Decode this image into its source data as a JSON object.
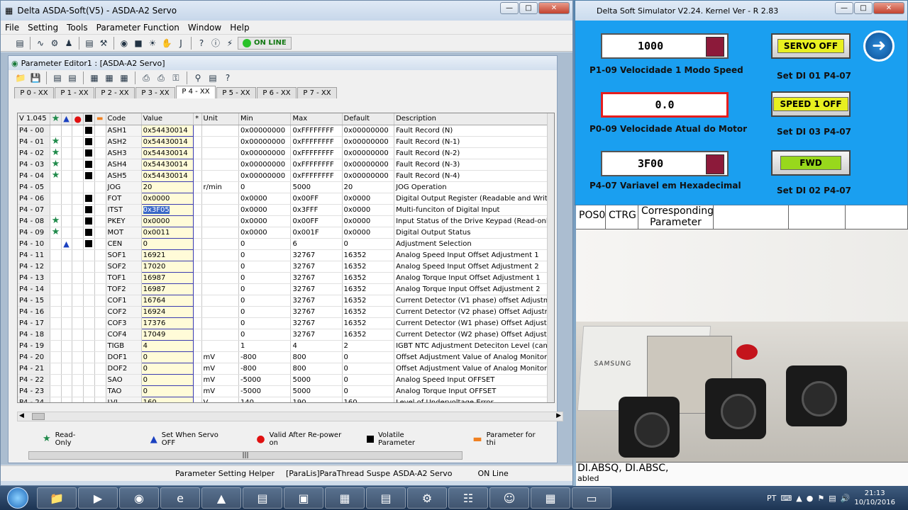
{
  "main_window": {
    "title": "Delta ASDA-Soft(V5) - ASDA-A2 Servo",
    "menu": [
      "File",
      "Setting",
      "Tools",
      "Parameter Function",
      "Window",
      "Help"
    ],
    "online_label": "ON LINE"
  },
  "editor": {
    "title": "Parameter Editor1 : [ASDA-A2 Servo]",
    "tabs": [
      "P 0 - XX",
      "P 1 - XX",
      "P 2 - XX",
      "P 3 - XX",
      "P 4 - XX",
      "P 5 - XX",
      "P 6 - XX",
      "P 7 - XX"
    ],
    "active_tab": 4,
    "headers": {
      "version": "V 1.045",
      "code": "Code",
      "value": "Value",
      "flag": "*",
      "unit": "Unit",
      "min": "Min",
      "max": "Max",
      "default": "Default",
      "description": "Description"
    },
    "rows": [
      {
        "p": "P4 - 00",
        "star": false,
        "tri": false,
        "sq": true,
        "code": "ASH1",
        "value": "0x54430014",
        "unit": "",
        "min": "0x00000000",
        "max": "0xFFFFFFFF",
        "def": "0x00000000",
        "desc": "Fault Record (N)"
      },
      {
        "p": "P4 - 01",
        "star": true,
        "tri": false,
        "sq": true,
        "code": "ASH2",
        "value": "0x54430014",
        "unit": "",
        "min": "0x00000000",
        "max": "0xFFFFFFFF",
        "def": "0x00000000",
        "desc": "Fault Record (N-1)"
      },
      {
        "p": "P4 - 02",
        "star": true,
        "tri": false,
        "sq": true,
        "code": "ASH3",
        "value": "0x54430014",
        "unit": "",
        "min": "0x00000000",
        "max": "0xFFFFFFFF",
        "def": "0x00000000",
        "desc": "Fault Record (N-2)"
      },
      {
        "p": "P4 - 03",
        "star": true,
        "tri": false,
        "sq": true,
        "code": "ASH4",
        "value": "0x54430014",
        "unit": "",
        "min": "0x00000000",
        "max": "0xFFFFFFFF",
        "def": "0x00000000",
        "desc": "Fault Record (N-3)"
      },
      {
        "p": "P4 - 04",
        "star": true,
        "tri": false,
        "sq": true,
        "code": "ASH5",
        "value": "0x54430014",
        "unit": "",
        "min": "0x00000000",
        "max": "0xFFFFFFFF",
        "def": "0x00000000",
        "desc": "Fault Record (N-4)"
      },
      {
        "p": "P4 - 05",
        "star": false,
        "tri": false,
        "sq": false,
        "code": "JOG",
        "value": "20",
        "unit": "r/min",
        "min": "0",
        "max": "5000",
        "def": "20",
        "desc": "JOG Operation"
      },
      {
        "p": "P4 - 06",
        "star": false,
        "tri": false,
        "sq": true,
        "code": "FOT",
        "value": "0x0000",
        "unit": "",
        "min": "0x0000",
        "max": "0x00FF",
        "def": "0x0000",
        "desc": "Digital Output Register (Readable and Writa"
      },
      {
        "p": "P4 - 07",
        "star": false,
        "tri": false,
        "sq": true,
        "code": "ITST",
        "value": "0x3F05",
        "unit": "",
        "min": "0x0000",
        "max": "0x3FFF",
        "def": "0x0000",
        "desc": "Multi-funciton of Digital Input",
        "selected": true
      },
      {
        "p": "P4 - 08",
        "star": true,
        "tri": false,
        "sq": true,
        "code": "PKEY",
        "value": "0x0000",
        "unit": "",
        "min": "0x0000",
        "max": "0x00FF",
        "def": "0x0000",
        "desc": "Input Status of the Drive Keypad (Read-onl"
      },
      {
        "p": "P4 - 09",
        "star": true,
        "tri": false,
        "sq": true,
        "code": "MOT",
        "value": "0x0011",
        "unit": "",
        "min": "0x0000",
        "max": "0x001F",
        "def": "0x0000",
        "desc": "Digital Output Status"
      },
      {
        "p": "P4 - 10",
        "star": false,
        "tri": true,
        "sq": true,
        "code": "CEN",
        "value": "0",
        "unit": "",
        "min": "0",
        "max": "6",
        "def": "0",
        "desc": "Adjustment Selection"
      },
      {
        "p": "P4 - 11",
        "star": false,
        "tri": false,
        "sq": false,
        "code": "SOF1",
        "value": "16921",
        "unit": "",
        "min": "0",
        "max": "32767",
        "def": "16352",
        "desc": "Analog Speed Input Offset Adjustment 1"
      },
      {
        "p": "P4 - 12",
        "star": false,
        "tri": false,
        "sq": false,
        "code": "SOF2",
        "value": "17020",
        "unit": "",
        "min": "0",
        "max": "32767",
        "def": "16352",
        "desc": "Analog Speed Input Offset Adjustment 2"
      },
      {
        "p": "P4 - 13",
        "star": false,
        "tri": false,
        "sq": false,
        "code": "TOF1",
        "value": "16987",
        "unit": "",
        "min": "0",
        "max": "32767",
        "def": "16352",
        "desc": "Analog Torque Input Offset Adjustment 1"
      },
      {
        "p": "P4 - 14",
        "star": false,
        "tri": false,
        "sq": false,
        "code": "TOF2",
        "value": "16987",
        "unit": "",
        "min": "0",
        "max": "32767",
        "def": "16352",
        "desc": "Analog Torque Input Offset Adjustment 2"
      },
      {
        "p": "P4 - 15",
        "star": false,
        "tri": false,
        "sq": false,
        "code": "COF1",
        "value": "16764",
        "unit": "",
        "min": "0",
        "max": "32767",
        "def": "16352",
        "desc": "Current Detector (V1 phase) offset Adjustm"
      },
      {
        "p": "P4 - 16",
        "star": false,
        "tri": false,
        "sq": false,
        "code": "COF2",
        "value": "16924",
        "unit": "",
        "min": "0",
        "max": "32767",
        "def": "16352",
        "desc": "Current Detector (V2 phase) Offset Adjustr"
      },
      {
        "p": "P4 - 17",
        "star": false,
        "tri": false,
        "sq": false,
        "code": "COF3",
        "value": "17376",
        "unit": "",
        "min": "0",
        "max": "32767",
        "def": "16352",
        "desc": "Current Detector (W1 phase) Offset Adjust"
      },
      {
        "p": "P4 - 18",
        "star": false,
        "tri": false,
        "sq": false,
        "code": "COF4",
        "value": "17049",
        "unit": "",
        "min": "0",
        "max": "32767",
        "def": "16352",
        "desc": "Current Detector (W2 phase) Offset Adjust"
      },
      {
        "p": "P4 - 19",
        "star": false,
        "tri": false,
        "sq": false,
        "code": "TIGB",
        "value": "4",
        "unit": "",
        "min": "1",
        "max": "4",
        "def": "2",
        "desc": "IGBT NTC Adjustment Deteciton Level (canr"
      },
      {
        "p": "P4 - 20",
        "star": false,
        "tri": false,
        "sq": false,
        "code": "DOF1",
        "value": "0",
        "unit": "mV",
        "min": "-800",
        "max": "800",
        "def": "0",
        "desc": "Offset Adjustment Value of Analog Monitor"
      },
      {
        "p": "P4 - 21",
        "star": false,
        "tri": false,
        "sq": false,
        "code": "DOF2",
        "value": "0",
        "unit": "mV",
        "min": "-800",
        "max": "800",
        "def": "0",
        "desc": "Offset Adjustment Value of Analog Monitor"
      },
      {
        "p": "P4 - 22",
        "star": false,
        "tri": false,
        "sq": false,
        "code": "SAO",
        "value": "0",
        "unit": "mV",
        "min": "-5000",
        "max": "5000",
        "def": "0",
        "desc": "Analog Speed Input OFFSET"
      },
      {
        "p": "P4 - 23",
        "star": false,
        "tri": false,
        "sq": false,
        "code": "TAO",
        "value": "0",
        "unit": "mV",
        "min": "-5000",
        "max": "5000",
        "def": "0",
        "desc": "Analog Torque Input OFFSET"
      },
      {
        "p": "P4 - 24",
        "star": false,
        "tri": false,
        "sq": false,
        "code": "LVL",
        "value": "160",
        "unit": "V",
        "min": "140",
        "max": "190",
        "def": "160",
        "desc": "Level of Undervoltage Error"
      }
    ],
    "legend": {
      "read_only": "Read-Only",
      "servo_off": "Set When Servo OFF",
      "repower": "Valid After Re-power on",
      "volatile": "Volatile Parameter",
      "param_for": "Parameter for thi"
    }
  },
  "statusbar": {
    "helper": "Parameter Setting Helper",
    "thread": "[ParaLis]ParaThread Suspe",
    "model": "ASDA-A2 Servo",
    "state": "ON Line"
  },
  "simulator": {
    "title": "Delta Soft Simulator V2.24. Kernel Ver - R 2.83",
    "displays": [
      {
        "value": "1000",
        "label": "P1-09 Velocidade 1 Modo Speed"
      },
      {
        "value": "0.0",
        "label": "P0-09 Velocidade Atual do Motor"
      },
      {
        "value": "3F00",
        "label": "P4-07 Variavel em Hexadecimal"
      }
    ],
    "buttons": [
      {
        "label": "SERVO OFF",
        "caption": "Set DI 01 P4-07"
      },
      {
        "label": "SPEED 1 OFF",
        "caption": "Set DI 03 P4-07"
      },
      {
        "label": "FWD",
        "caption": "Set DI 02 P4-07"
      }
    ]
  },
  "background": {
    "table_cells": [
      "POS0",
      "CTRG",
      "Corresponding Parameter"
    ],
    "bottom_text": "DI.ABSQ, DI.ABSC,",
    "bottom_text2": "abled",
    "brand": "SAMSUNG"
  },
  "taskbar": {
    "lang": "PT",
    "time": "21:13",
    "date": "10/10/2016"
  }
}
